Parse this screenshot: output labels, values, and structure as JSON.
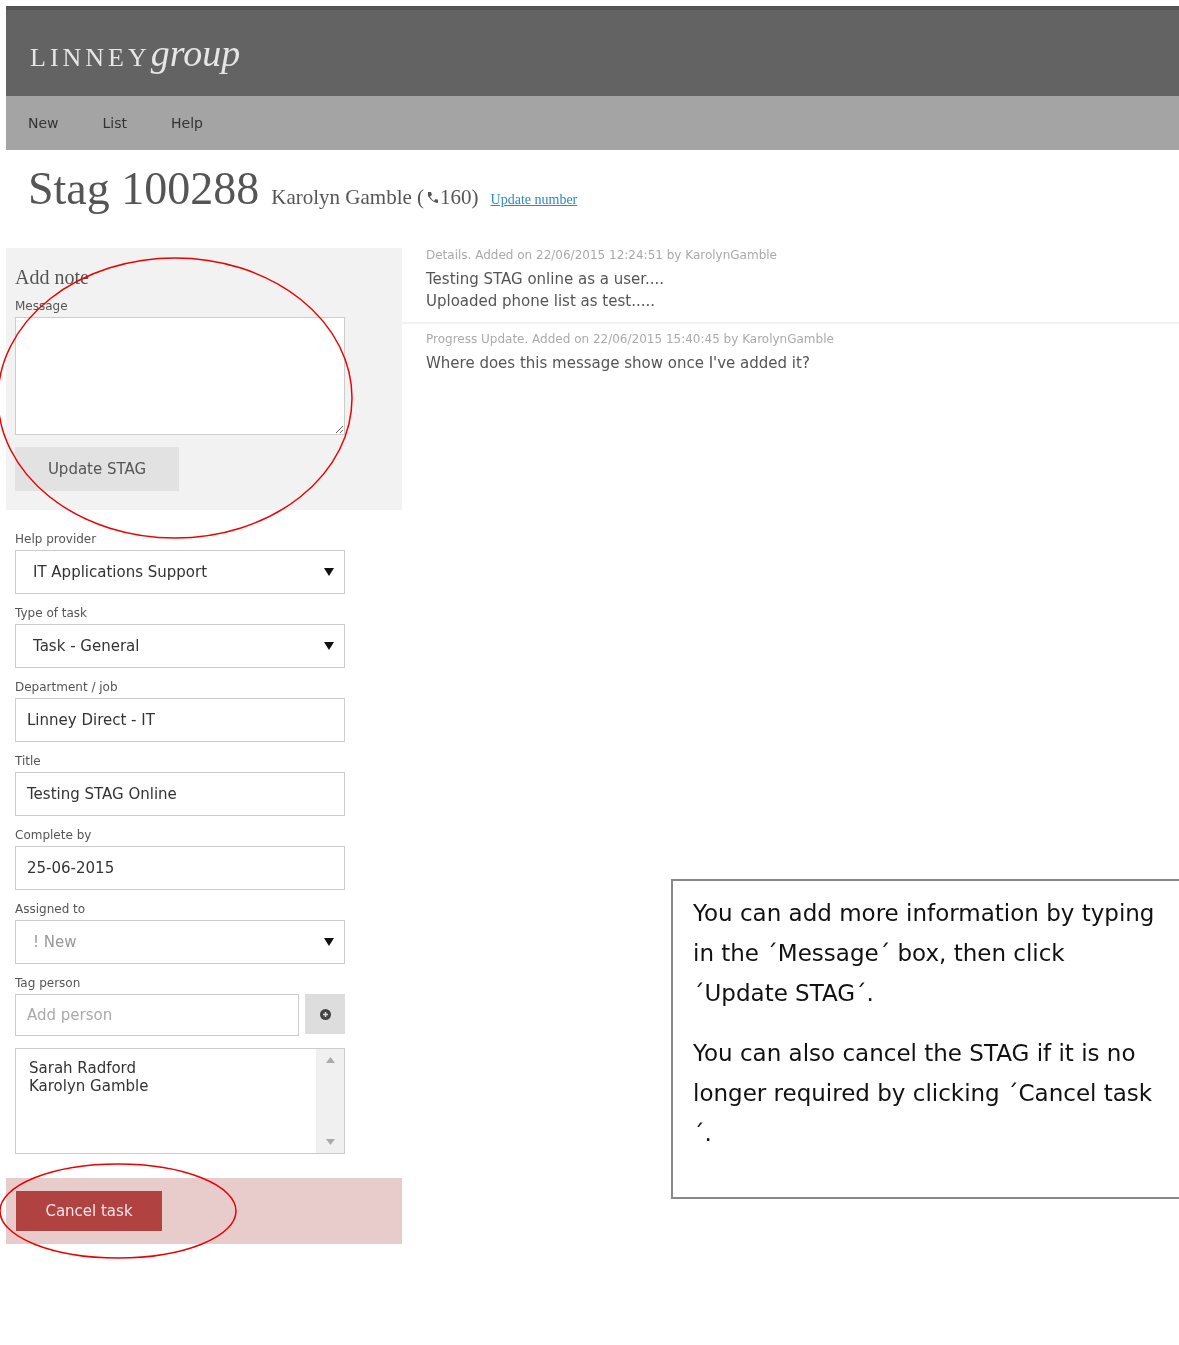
{
  "header": {
    "logo_caps": "LINNEY",
    "logo_script": "group"
  },
  "nav": [
    {
      "label": "New"
    },
    {
      "label": "List"
    },
    {
      "label": "Help"
    }
  ],
  "title": {
    "heading": "Stag 100288",
    "person": "Karolyn Gamble (",
    "extension": "160)",
    "link": "Update number"
  },
  "add_note": {
    "heading": "Add note",
    "message_label": "Message",
    "button": "Update STAG",
    "circled": true
  },
  "fields": [
    {
      "kind": "select",
      "label": "Help provider",
      "value": "IT Applications Support"
    },
    {
      "kind": "select",
      "label": "Type of task",
      "value": "Task - General"
    },
    {
      "kind": "text",
      "label": "Department / job",
      "value": "Linney Direct - IT"
    },
    {
      "kind": "text",
      "label": "Title",
      "value": "Testing STAG Online"
    },
    {
      "kind": "text",
      "label": "Complete by",
      "value": "25-06-2015"
    },
    {
      "kind": "select",
      "label": "Assigned to",
      "value": "! New",
      "muted": true
    }
  ],
  "tag_person": {
    "label": "Tag person",
    "placeholder": "Add person",
    "people": [
      "Sarah Radford",
      "Karolyn Gamble"
    ]
  },
  "cancel": {
    "button": "Cancel task",
    "circled": true
  },
  "notes": [
    {
      "meta": "Details. Added on 22/06/2015 12:24:51 by KarolynGamble",
      "lines": [
        "Testing STAG online as a user....",
        "Uploaded phone list as test....."
      ]
    },
    {
      "meta": "Progress Update. Added on 22/06/2015 15:40:45 by KarolynGamble",
      "lines": [
        "Where  does this message show once I've added it?"
      ]
    }
  ],
  "callout": [
    "You can add more information by typing in the ´Message´ box, then click ´Update STAG´.",
    "You can also cancel the STAG if it is no longer required by clicking ´Cancel task´."
  ]
}
